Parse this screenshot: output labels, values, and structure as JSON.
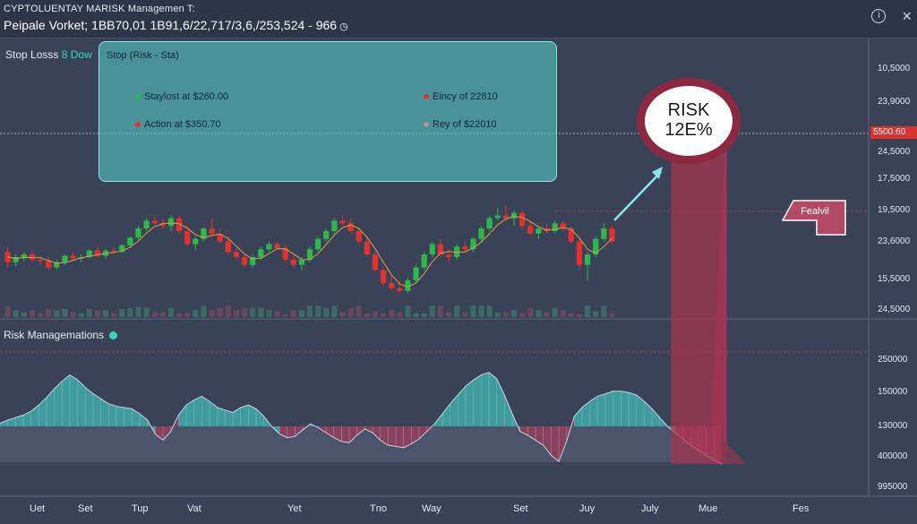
{
  "header": {
    "title": "CYPTOLUENTAY MARISK Managemen T:",
    "subtitle": "Peipale Vorket; 1BB70,01 1B91,6/22,717/3,6,/253,524 - 966"
  },
  "colors": {
    "background": "#3a4258",
    "bull": "#2db84b",
    "bear": "#e0322f",
    "teal": "#54c4c4",
    "risk_zone": "#a83450",
    "osc_pos": "#3fa6a6",
    "osc_neg": "#9e3c5a"
  },
  "icons": [
    "clock-icon",
    "info-icon",
    "close-icon"
  ],
  "top_panel": {
    "label": "Stop Losss",
    "label_accent": "8 Dow"
  },
  "stop_box": {
    "title": "Stop (Risk - Sta)",
    "entries": [
      {
        "text": "Staylost at $260.00",
        "color": "#2db84b"
      },
      {
        "text": "Eincy of 22810",
        "color": "#e0322f"
      },
      {
        "text": "Action at $350.70",
        "color": "#e0322f"
      },
      {
        "text": "Rey of $22010",
        "color": "#b98ca0"
      }
    ]
  },
  "risk_badge": {
    "line1": "RISK",
    "line2": "12E%"
  },
  "tag": "Fealvil",
  "bottom_panel": {
    "label": "Risk Managemations"
  },
  "right_axis_top": [
    "10,5000",
    "23,9000",
    "24,5000",
    "17,5000",
    "19,5000",
    "23,6000",
    "15,5000",
    "24,5000"
  ],
  "price_flag": "5500.60",
  "right_axis_bottom": [
    "250000",
    "150000",
    "130000",
    "400000",
    "995000"
  ],
  "x_labels": [
    "Uet",
    "Set",
    "Tup",
    "Vat",
    "Yet",
    "Tno",
    "Way",
    "Set",
    "Juy",
    "July",
    "Mue",
    "Fes"
  ],
  "chart_data": [
    {
      "type": "candlestick",
      "title": "",
      "xlabel": "",
      "ylabel": "",
      "y_tick_labels": [
        "10,5000",
        "23,9000",
        "5500.60",
        "24,5000",
        "17,5000",
        "19,5000",
        "23,6000",
        "15,5000",
        "24,5000"
      ],
      "x_tick_labels": [
        "Uet",
        "Set",
        "Tup",
        "Vat",
        "Yet",
        "Tno",
        "Way",
        "Set",
        "Juy",
        "July",
        "Mue",
        "Fes"
      ],
      "ylim": [
        0,
        100
      ],
      "grid": false,
      "candles": [
        {
          "o": 44,
          "h": 48,
          "l": 32,
          "c": 36
        },
        {
          "o": 36,
          "h": 42,
          "l": 33,
          "c": 40
        },
        {
          "o": 40,
          "h": 44,
          "l": 37,
          "c": 42
        },
        {
          "o": 42,
          "h": 45,
          "l": 36,
          "c": 38
        },
        {
          "o": 38,
          "h": 41,
          "l": 34,
          "c": 37
        },
        {
          "o": 37,
          "h": 40,
          "l": 30,
          "c": 32
        },
        {
          "o": 32,
          "h": 38,
          "l": 30,
          "c": 36
        },
        {
          "o": 36,
          "h": 42,
          "l": 34,
          "c": 41
        },
        {
          "o": 41,
          "h": 44,
          "l": 37,
          "c": 39
        },
        {
          "o": 39,
          "h": 42,
          "l": 36,
          "c": 40
        },
        {
          "o": 40,
          "h": 46,
          "l": 39,
          "c": 45
        },
        {
          "o": 45,
          "h": 48,
          "l": 40,
          "c": 41
        },
        {
          "o": 41,
          "h": 46,
          "l": 39,
          "c": 45
        },
        {
          "o": 45,
          "h": 48,
          "l": 43,
          "c": 44
        },
        {
          "o": 44,
          "h": 50,
          "l": 43,
          "c": 49
        },
        {
          "o": 49,
          "h": 56,
          "l": 48,
          "c": 55
        },
        {
          "o": 55,
          "h": 64,
          "l": 53,
          "c": 62
        },
        {
          "o": 62,
          "h": 70,
          "l": 60,
          "c": 68
        },
        {
          "o": 68,
          "h": 72,
          "l": 64,
          "c": 66
        },
        {
          "o": 66,
          "h": 70,
          "l": 62,
          "c": 64
        },
        {
          "o": 64,
          "h": 72,
          "l": 60,
          "c": 70
        },
        {
          "o": 70,
          "h": 72,
          "l": 58,
          "c": 60
        },
        {
          "o": 60,
          "h": 64,
          "l": 48,
          "c": 50
        },
        {
          "o": 50,
          "h": 56,
          "l": 45,
          "c": 54
        },
        {
          "o": 54,
          "h": 63,
          "l": 52,
          "c": 62
        },
        {
          "o": 62,
          "h": 70,
          "l": 56,
          "c": 58
        },
        {
          "o": 58,
          "h": 62,
          "l": 50,
          "c": 52
        },
        {
          "o": 52,
          "h": 56,
          "l": 42,
          "c": 44
        },
        {
          "o": 44,
          "h": 47,
          "l": 38,
          "c": 40
        },
        {
          "o": 40,
          "h": 42,
          "l": 32,
          "c": 34
        },
        {
          "o": 34,
          "h": 42,
          "l": 32,
          "c": 40
        },
        {
          "o": 40,
          "h": 48,
          "l": 38,
          "c": 46
        },
        {
          "o": 46,
          "h": 52,
          "l": 44,
          "c": 50
        },
        {
          "o": 50,
          "h": 52,
          "l": 46,
          "c": 47
        },
        {
          "o": 47,
          "h": 50,
          "l": 36,
          "c": 38
        },
        {
          "o": 38,
          "h": 42,
          "l": 32,
          "c": 34
        },
        {
          "o": 34,
          "h": 40,
          "l": 30,
          "c": 38
        },
        {
          "o": 38,
          "h": 48,
          "l": 36,
          "c": 46
        },
        {
          "o": 46,
          "h": 56,
          "l": 44,
          "c": 54
        },
        {
          "o": 54,
          "h": 62,
          "l": 52,
          "c": 60
        },
        {
          "o": 60,
          "h": 70,
          "l": 58,
          "c": 68
        },
        {
          "o": 68,
          "h": 72,
          "l": 64,
          "c": 66
        },
        {
          "o": 66,
          "h": 70,
          "l": 58,
          "c": 60
        },
        {
          "o": 60,
          "h": 62,
          "l": 50,
          "c": 52
        },
        {
          "o": 52,
          "h": 56,
          "l": 40,
          "c": 42
        },
        {
          "o": 42,
          "h": 44,
          "l": 28,
          "c": 30
        },
        {
          "o": 30,
          "h": 32,
          "l": 18,
          "c": 20
        },
        {
          "o": 20,
          "h": 26,
          "l": 14,
          "c": 16
        },
        {
          "o": 16,
          "h": 22,
          "l": 12,
          "c": 14
        },
        {
          "o": 14,
          "h": 24,
          "l": 12,
          "c": 22
        },
        {
          "o": 22,
          "h": 34,
          "l": 20,
          "c": 32
        },
        {
          "o": 32,
          "h": 44,
          "l": 30,
          "c": 42
        },
        {
          "o": 42,
          "h": 52,
          "l": 40,
          "c": 50
        },
        {
          "o": 50,
          "h": 54,
          "l": 40,
          "c": 42
        },
        {
          "o": 42,
          "h": 46,
          "l": 36,
          "c": 40
        },
        {
          "o": 40,
          "h": 50,
          "l": 38,
          "c": 48
        },
        {
          "o": 48,
          "h": 52,
          "l": 44,
          "c": 46
        },
        {
          "o": 46,
          "h": 56,
          "l": 44,
          "c": 54
        },
        {
          "o": 54,
          "h": 64,
          "l": 52,
          "c": 62
        },
        {
          "o": 62,
          "h": 72,
          "l": 60,
          "c": 70
        },
        {
          "o": 70,
          "h": 78,
          "l": 68,
          "c": 72
        },
        {
          "o": 72,
          "h": 80,
          "l": 68,
          "c": 70
        },
        {
          "o": 70,
          "h": 76,
          "l": 64,
          "c": 74
        },
        {
          "o": 74,
          "h": 76,
          "l": 62,
          "c": 64
        },
        {
          "o": 64,
          "h": 68,
          "l": 56,
          "c": 58
        },
        {
          "o": 58,
          "h": 64,
          "l": 54,
          "c": 62
        },
        {
          "o": 62,
          "h": 66,
          "l": 58,
          "c": 60
        },
        {
          "o": 60,
          "h": 68,
          "l": 58,
          "c": 66
        },
        {
          "o": 66,
          "h": 68,
          "l": 60,
          "c": 62
        },
        {
          "o": 62,
          "h": 64,
          "l": 50,
          "c": 52
        },
        {
          "o": 52,
          "h": 54,
          "l": 30,
          "c": 34
        },
        {
          "o": 34,
          "h": 44,
          "l": 22,
          "c": 42
        },
        {
          "o": 42,
          "h": 56,
          "l": 40,
          "c": 54
        },
        {
          "o": 54,
          "h": 66,
          "l": 52,
          "c": 62
        },
        {
          "o": 62,
          "h": 64,
          "l": 50,
          "c": 52
        }
      ]
    },
    {
      "type": "area",
      "title": "",
      "xlabel": "",
      "ylabel": "",
      "y_tick_labels": [
        "250000",
        "150000",
        "130000",
        "400000",
        "995000"
      ],
      "baseline": 0,
      "ylim": [
        -60,
        100
      ],
      "values": [
        5,
        10,
        14,
        18,
        24,
        34,
        46,
        60,
        72,
        82,
        74,
        62,
        52,
        44,
        36,
        32,
        30,
        28,
        20,
        10,
        -12,
        -22,
        -8,
        18,
        34,
        42,
        48,
        40,
        30,
        26,
        22,
        30,
        34,
        28,
        16,
        0,
        -12,
        -18,
        -16,
        -6,
        4,
        -2,
        -10,
        -18,
        -24,
        -26,
        -14,
        -4,
        -10,
        -22,
        -30,
        -32,
        -34,
        -28,
        -20,
        -8,
        4,
        20,
        36,
        50,
        64,
        74,
        82,
        86,
        76,
        50,
        20,
        -8,
        -14,
        -22,
        -30,
        -46,
        -56,
        -24,
        16,
        30,
        40,
        48,
        52,
        56,
        56,
        54,
        50,
        40,
        28,
        14,
        0,
        -10,
        -20,
        -30,
        -38,
        -46,
        -54,
        -60
      ],
      "risk_zone": {
        "x_start": 0.72,
        "x_end": 0.82
      }
    }
  ]
}
